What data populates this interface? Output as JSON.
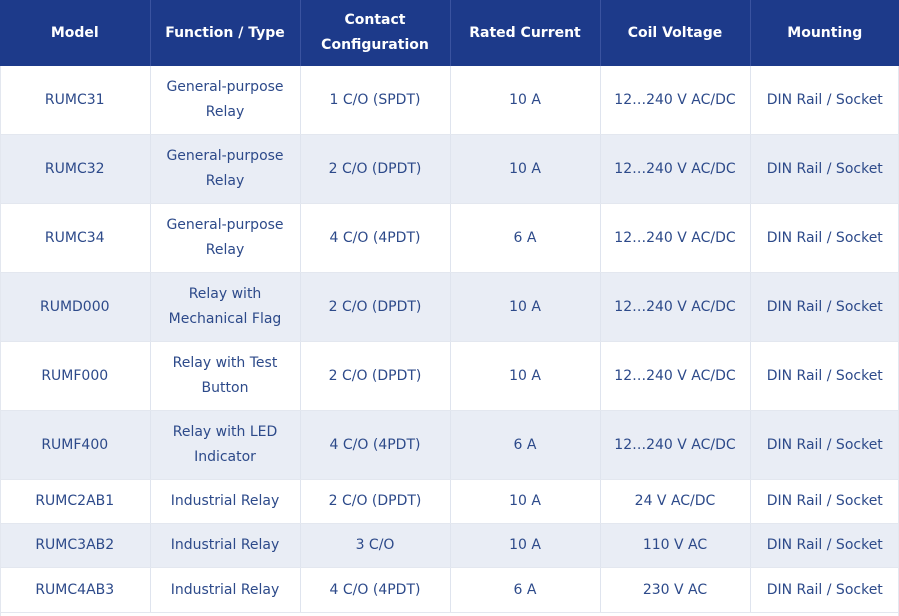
{
  "table": {
    "headers": [
      "Model",
      "Function / Type",
      "Contact Configuration",
      "Rated Current",
      "Coil Voltage",
      "Mounting"
    ],
    "rows": [
      [
        "RUMC31",
        "General-purpose Relay",
        "1 C/O (SPDT)",
        "10 A",
        "12…240 V AC/DC",
        "DIN Rail / Socket"
      ],
      [
        "RUMC32",
        "General-purpose Relay",
        "2 C/O (DPDT)",
        "10 A",
        "12…240 V AC/DC",
        "DIN Rail / Socket"
      ],
      [
        "RUMC34",
        "General-purpose Relay",
        "4 C/O (4PDT)",
        "6 A",
        "12…240 V AC/DC",
        "DIN Rail / Socket"
      ],
      [
        "RUMD000",
        "Relay with Mechanical Flag",
        "2 C/O (DPDT)",
        "10 A",
        "12…240 V AC/DC",
        "DIN Rail / Socket"
      ],
      [
        "RUMF000",
        "Relay with Test Button",
        "2 C/O (DPDT)",
        "10 A",
        "12…240 V AC/DC",
        "DIN Rail / Socket"
      ],
      [
        "RUMF400",
        "Relay with LED Indicator",
        "4 C/O (4PDT)",
        "6 A",
        "12…240 V AC/DC",
        "DIN Rail / Socket"
      ],
      [
        "RUMC2AB1",
        "Industrial Relay",
        "2 C/O (DPDT)",
        "10 A",
        "24 V AC/DC",
        "DIN Rail / Socket"
      ],
      [
        "RUMC3AB2",
        "Industrial Relay",
        "3 C/O",
        "10 A",
        "110 V AC",
        "DIN Rail / Socket"
      ],
      [
        "RUMC4AB3",
        "Industrial Relay",
        "4 C/O (4PDT)",
        "6 A",
        "230 V AC",
        "DIN Rail / Socket"
      ]
    ]
  },
  "colors": {
    "header_bg": "#1d3a8a",
    "header_text": "#ffffff",
    "cell_text": "#2d4a8a",
    "row_odd_bg": "#ffffff",
    "row_even_bg": "#e9edf5"
  }
}
